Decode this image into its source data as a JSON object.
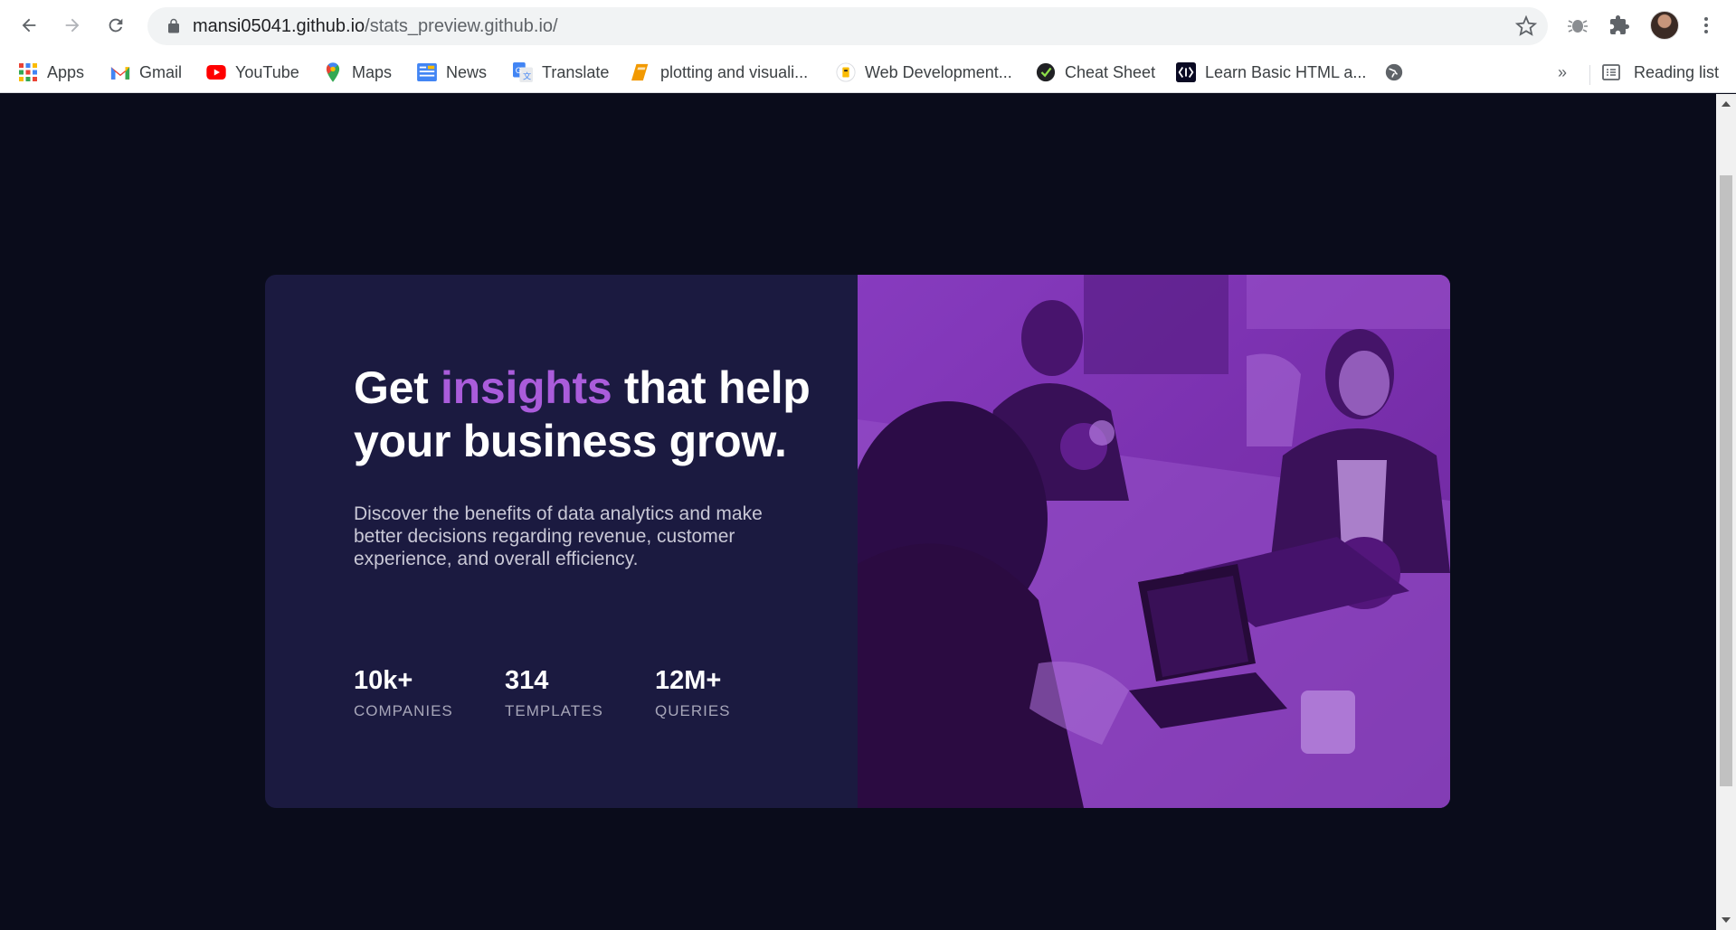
{
  "browser": {
    "url_host": "mansi05041.github.io",
    "url_path": "/stats_preview.github.io/",
    "bookmarks": [
      {
        "label": "Apps",
        "icon": "apps-grid-icon"
      },
      {
        "label": "Gmail",
        "icon": "gmail-icon"
      },
      {
        "label": "YouTube",
        "icon": "youtube-icon"
      },
      {
        "label": "Maps",
        "icon": "maps-icon"
      },
      {
        "label": "News",
        "icon": "news-icon"
      },
      {
        "label": "Translate",
        "icon": "translate-icon"
      },
      {
        "label": "plotting and visuali...",
        "icon": "notebook-icon"
      },
      {
        "label": "Web Development...",
        "icon": "web-dev-icon"
      },
      {
        "label": "Cheat Sheet",
        "icon": "cheat-sheet-icon"
      },
      {
        "label": "Learn Basic HTML a...",
        "icon": "learn-html-icon"
      },
      {
        "label": "",
        "icon": "globe-icon"
      }
    ],
    "more_label": "»",
    "reading_list_label": "Reading list"
  },
  "card": {
    "headline_pre": "Get ",
    "headline_accent": "insights",
    "headline_post": " that help your business grow.",
    "lead": "Discover the benefits of data analytics and make better decisions regarding revenue, customer experience, and overall efficiency.",
    "stats": [
      {
        "value": "10k+",
        "label": "COMPANIES"
      },
      {
        "value": "314",
        "label": "TEMPLATES"
      },
      {
        "value": "12M+",
        "label": "QUERIES"
      }
    ],
    "image_subject": "women-working-at-table-with-laptop-photo",
    "colors": {
      "background": "#0a0c1b",
      "card": "#1b1a40",
      "accent": "#aa5cdb",
      "overlay": "#7b2db0"
    }
  }
}
